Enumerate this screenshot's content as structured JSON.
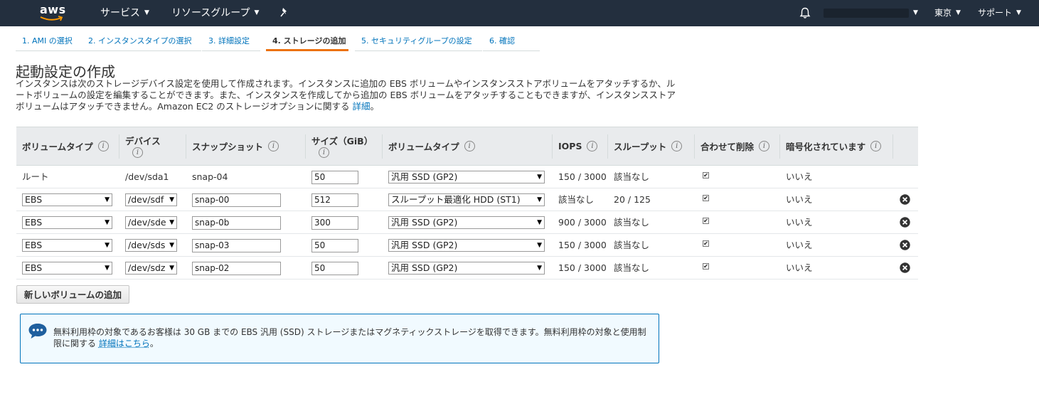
{
  "topbar": {
    "logo": "aws",
    "services": "サービス",
    "resource_groups": "リソースグループ",
    "region": "東京",
    "support": "サポート",
    "colors": {
      "background": "#232f3e"
    }
  },
  "steps": [
    {
      "label": "1. AMI の選択",
      "active": false
    },
    {
      "label": "2. インスタンスタイプの選択",
      "active": false
    },
    {
      "label": "3. 詳細設定",
      "active": false
    },
    {
      "label": "4. ストレージの追加",
      "active": true
    },
    {
      "label": "5. セキュリティグループの設定",
      "active": false
    },
    {
      "label": "6. 確認",
      "active": false
    }
  ],
  "page": {
    "title": "起動設定の作成",
    "description": "インスタンスは次のストレージデバイス設定を使用して作成されます。インスタンスに追加の EBS ボリュームやインスタンスストアボリュームをアタッチするか、ルートボリュームの設定を編集することができます。また、インスタンスを作成してから追加の EBS ボリュームをアタッチすることもできますが、インスタンスストアボリュームはアタッチできません。Amazon EC2 のストレージオプションに関する",
    "description_link": "詳細",
    "description_end": "。"
  },
  "table": {
    "headers": {
      "volume_type": "ボリュームタイプ",
      "device": "デバイス",
      "snapshot": "スナップショット",
      "size": "サイズ（GiB）",
      "ebs_type": "ボリュームタイプ",
      "iops": "IOPS",
      "throughput": "スループット",
      "delete_on_termination": "合わせて削除",
      "encrypted": "暗号化されています"
    },
    "info_glyph": "i",
    "rows": [
      {
        "volume_type": "ルート",
        "device": "/dev/sda1",
        "snapshot": "snap-04",
        "size": "50",
        "ebs_type": "汎用 SSD (GP2)",
        "iops": "150 / 3000",
        "throughput": "該当なし",
        "delete_on_termination": true,
        "encrypted": "いいえ",
        "root": true
      },
      {
        "volume_type": "EBS",
        "device": "/dev/sdf",
        "snapshot": "snap-00",
        "size": "512",
        "ebs_type": "スループット最適化 HDD (ST1)",
        "iops": "該当なし",
        "throughput": "20 / 125",
        "delete_on_termination": true,
        "encrypted": "いいえ",
        "root": false
      },
      {
        "volume_type": "EBS",
        "device": "/dev/sde",
        "snapshot": "snap-0b",
        "size": "300",
        "ebs_type": "汎用 SSD (GP2)",
        "iops": "900 / 3000",
        "throughput": "該当なし",
        "delete_on_termination": true,
        "encrypted": "いいえ",
        "root": false
      },
      {
        "volume_type": "EBS",
        "device": "/dev/sds",
        "snapshot": "snap-03",
        "size": "50",
        "ebs_type": "汎用 SSD (GP2)",
        "iops": "150 / 3000",
        "throughput": "該当なし",
        "delete_on_termination": true,
        "encrypted": "いいえ",
        "root": false
      },
      {
        "volume_type": "EBS",
        "device": "/dev/sdz",
        "snapshot": "snap-02",
        "size": "50",
        "ebs_type": "汎用 SSD (GP2)",
        "iops": "150 / 3000",
        "throughput": "該当なし",
        "delete_on_termination": true,
        "encrypted": "いいえ",
        "root": false
      }
    ]
  },
  "add_volume_label": "新しいボリュームの追加",
  "info_box": {
    "text": "無料利用枠の対象であるお客様は 30 GB までの EBS 汎用 (SSD) ストレージまたはマグネティックストレージを取得できます。無料利用枠の対象と使用制限に関する",
    "link": "詳細はこちら",
    "end": "。",
    "colors": {
      "background": "#f1faff",
      "border": "#0073bb"
    }
  }
}
